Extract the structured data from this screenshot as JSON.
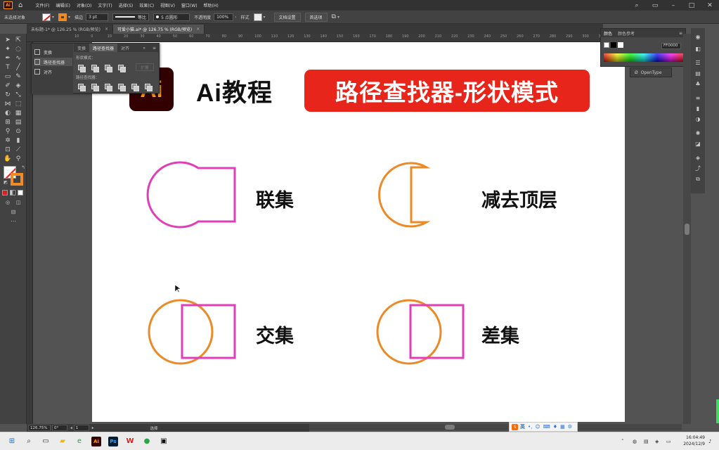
{
  "menubar": {
    "app_icon": "Ai",
    "items": [
      "文件(F)",
      "编辑(E)",
      "对象(O)",
      "文字(T)",
      "选择(S)",
      "效果(C)",
      "视图(V)",
      "窗口(W)",
      "帮助(H)"
    ]
  },
  "controlbar": {
    "selection_label": "未选择对象",
    "stroke_label": "描边",
    "stroke_value": "3 pt",
    "line_style": "等比",
    "brush": "5 点圆形",
    "opacity_label": "不透明度",
    "opacity_value": "100%",
    "style_label": "样式",
    "doc_setup_button": "文档设置",
    "preferences_button": "首选项"
  },
  "tabs": [
    {
      "label": "未标题-1* @ 126.25 % (RGB/预览)",
      "close": "×"
    },
    {
      "label": "可爱小猫.ai* @ 126.75 % (RGB/预览)",
      "close": "×"
    }
  ],
  "ruler_numbers": [
    "10",
    "0",
    "10",
    "20",
    "30",
    "40",
    "50",
    "60",
    "70",
    "80",
    "90",
    "100",
    "110",
    "120",
    "130",
    "140",
    "150",
    "160",
    "170",
    "180",
    "190",
    "200",
    "210",
    "220",
    "230",
    "240",
    "250",
    "260",
    "270",
    "280",
    "290",
    "300",
    "310"
  ],
  "pathfinder_panel": {
    "side_items": [
      "变换",
      "路径查找器",
      "对齐"
    ],
    "tabs": [
      "变换",
      "路径查找器",
      "对齐"
    ],
    "shape_modes_label": "形状模式：",
    "pathfinders_label": "路径查找器：",
    "expand_button": "扩展"
  },
  "color_panel": {
    "tabs": [
      "颜色",
      "颜色参考"
    ],
    "hex_value": "FF0000"
  },
  "opentype_panel": {
    "label": "OpenType"
  },
  "artboard": {
    "logo_text": "Ai",
    "title_left": "Ai教程",
    "title_banner": "路径查找器-形状模式",
    "labels": {
      "union": "联集",
      "minus_front": "减去顶层",
      "intersect": "交集",
      "exclude": "差集"
    },
    "colors": {
      "magenta": "#e03fb8",
      "orange": "#eb8a26",
      "banner": "#e8251a"
    }
  },
  "statusbar": {
    "zoom": "126.75%",
    "rotation": "0°",
    "page": "1",
    "tool": "选择"
  },
  "ime": {
    "logo": "S",
    "lang": "英"
  },
  "taskbar": {
    "time": "16:04:49",
    "date": "2024/12/9"
  }
}
